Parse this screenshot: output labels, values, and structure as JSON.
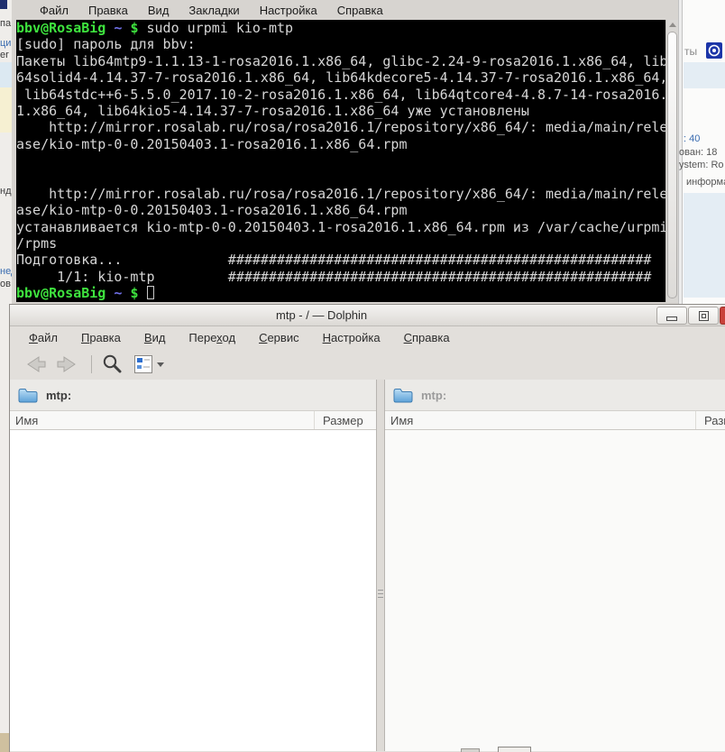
{
  "konsole": {
    "menu": [
      "Файл",
      "Правка",
      "Вид",
      "Закладки",
      "Настройка",
      "Справка"
    ],
    "prompt_user": "bbv@RosaBig",
    "prompt_tilde": "~",
    "prompt_dollar": "$",
    "terminal_lines": [
      {
        "kind": "prompt",
        "text": "sudo urpmi kio-mtp"
      },
      {
        "kind": "text",
        "text": "[sudo] пароль для bbv:"
      },
      {
        "kind": "text",
        "text": "Пакеты lib64mtp9-1.1.13-1-rosa2016.1.x86_64, glibc-2.24-9-rosa2016.1.x86_64, lib"
      },
      {
        "kind": "text",
        "text": "64solid4-4.14.37-7-rosa2016.1.x86_64, lib64kdecore5-4.14.37-7-rosa2016.1.x86_64,"
      },
      {
        "kind": "text",
        "text": " lib64stdc++6-5.5.0_2017.10-2-rosa2016.1.x86_64, lib64qtcore4-4.8.7-14-rosa2016."
      },
      {
        "kind": "text",
        "text": "1.x86_64, lib64kio5-4.14.37-7-rosa2016.1.x86_64 уже установлены"
      },
      {
        "kind": "text",
        "text": "    http://mirror.rosalab.ru/rosa/rosa2016.1/repository/x86_64/: media/main/rele"
      },
      {
        "kind": "text",
        "text": "ase/kio-mtp-0-0.20150403.1-rosa2016.1.x86_64.rpm"
      },
      {
        "kind": "text",
        "text": ""
      },
      {
        "kind": "text",
        "text": ""
      },
      {
        "kind": "text",
        "text": "    http://mirror.rosalab.ru/rosa/rosa2016.1/repository/x86_64/: media/main/rele"
      },
      {
        "kind": "text",
        "text": "ase/kio-mtp-0-0.20150403.1-rosa2016.1.x86_64.rpm"
      },
      {
        "kind": "text",
        "text": "устанавливается kio-mtp-0-0.20150403.1-rosa2016.1.x86_64.rpm из /var/cache/urpmi"
      },
      {
        "kind": "text",
        "text": "/rpms"
      },
      {
        "kind": "text",
        "text": "Подготовка...             ####################################################"
      },
      {
        "kind": "text",
        "text": "     1/1: kio-mtp         ####################################################"
      },
      {
        "kind": "prompt_cursor",
        "text": ""
      }
    ]
  },
  "dolphin": {
    "title": "mtp - / — Dolphin",
    "menu": [
      {
        "pre": "",
        "key": "Ф",
        "post": "айл"
      },
      {
        "pre": "",
        "key": "П",
        "post": "равка"
      },
      {
        "pre": "",
        "key": "В",
        "post": "ид"
      },
      {
        "pre": "Пере",
        "key": "х",
        "post": "од"
      },
      {
        "pre": "",
        "key": "С",
        "post": "ервис"
      },
      {
        "pre": "",
        "key": "Н",
        "post": "астройка"
      },
      {
        "pre": "",
        "key": "С",
        "post": "правка"
      }
    ],
    "left_pane": {
      "url": "mtp:",
      "col_name": "Имя",
      "col_size": "Размер"
    },
    "right_pane": {
      "url": "mtp:",
      "col_name": "Имя",
      "col_size": "Размер"
    }
  },
  "background": {
    "left": {
      "f1": "па",
      "f2": "циа.",
      "f3": "er p",
      "f4": "нды",
      "f5": "нед",
      "f6": "ов"
    },
    "right": {
      "f1": "ты",
      "f2": ": 40",
      "f3": "ован: 18",
      "f4": "ystem: Ro",
      "f5": "информа"
    }
  },
  "colors": {
    "accent_blue": "#3a6cb0",
    "close_red": "#c9413b",
    "terminal_green": "#3ee33e",
    "terminal_blue": "#7070e8",
    "folder_blue": "#5da2d8"
  }
}
